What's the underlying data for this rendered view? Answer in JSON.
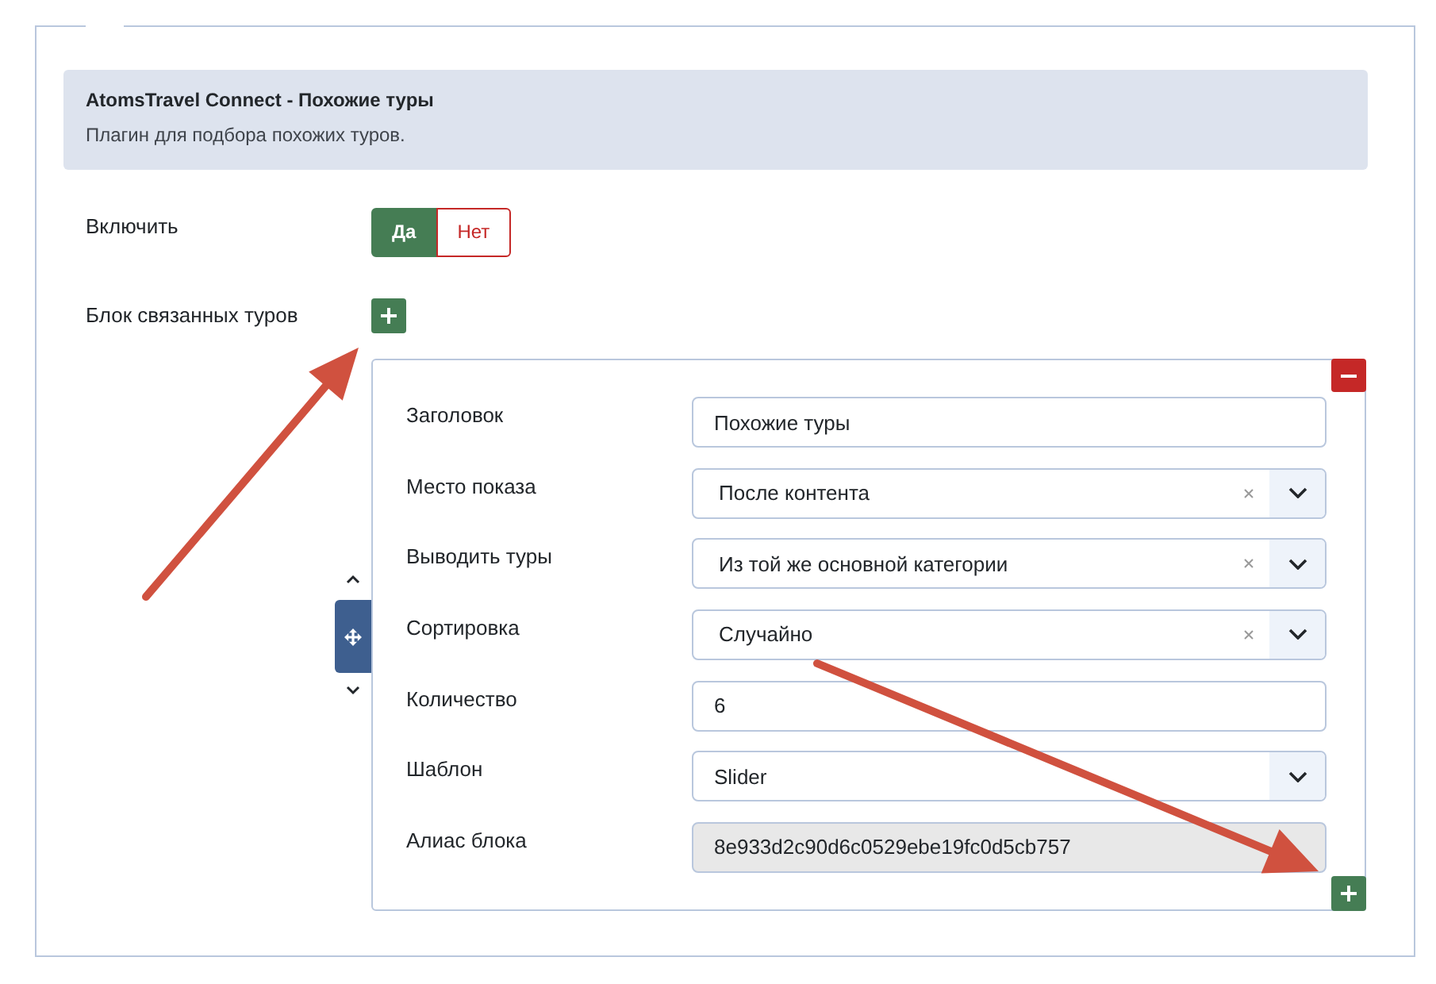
{
  "info": {
    "title": "AtomsTravel Connect - Похожие туры",
    "description": "Плагин для подбора похожих туров."
  },
  "enable": {
    "label": "Включить",
    "options": [
      {
        "label": "Да",
        "selected": true
      },
      {
        "label": "Нет",
        "selected": false
      }
    ]
  },
  "related_block": {
    "label": "Блок связанных туров"
  },
  "subform": {
    "fields": [
      {
        "label": "Заголовок",
        "kind": "text",
        "value": "Похожие туры",
        "disabled": false
      },
      {
        "label": "Место показа",
        "kind": "select",
        "value": "После контента",
        "clearable": true
      },
      {
        "label": "Выводить туры",
        "kind": "select",
        "value": "Из той же основной категории",
        "clearable": true
      },
      {
        "label": "Сортировка",
        "kind": "select",
        "value": "Случайно",
        "clearable": true
      },
      {
        "label": "Количество",
        "kind": "text",
        "value": "6",
        "disabled": false
      },
      {
        "label": "Шаблон",
        "kind": "select",
        "value": "Slider",
        "clearable": false
      },
      {
        "label": "Алиас блока",
        "kind": "text",
        "value": "8e933d2c90d6c0529ebe19fc0d5cb757",
        "disabled": true
      }
    ]
  }
}
